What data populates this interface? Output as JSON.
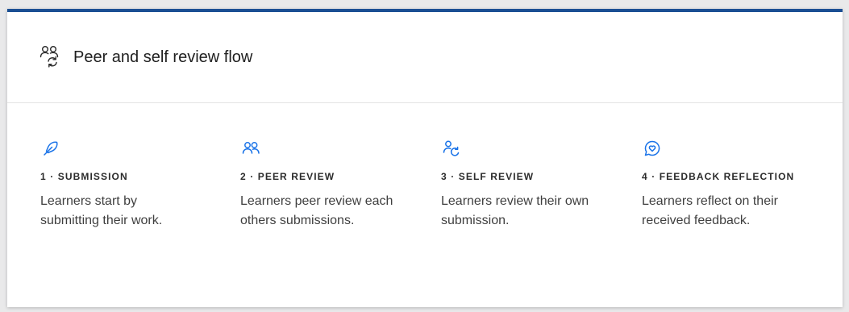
{
  "card": {
    "title": "Peer and self review flow",
    "icon": "people-sync-icon",
    "accent_color": "#1b4f93",
    "icon_color": "#1a73e8"
  },
  "steps": [
    {
      "icon": "feather-icon",
      "title": "1 · SUBMISSION",
      "description": "Learners start by submitting their work."
    },
    {
      "icon": "people-icon",
      "title": "2 · PEER REVIEW",
      "description": "Learners peer review each others submissions."
    },
    {
      "icon": "person-refresh-icon",
      "title": "3 · SELF REVIEW",
      "description": "Learners review their own submission."
    },
    {
      "icon": "heart-chat-icon",
      "title": "4 · FEEDBACK REFLECTION",
      "description": "Learners reflect on their received feedback."
    }
  ]
}
